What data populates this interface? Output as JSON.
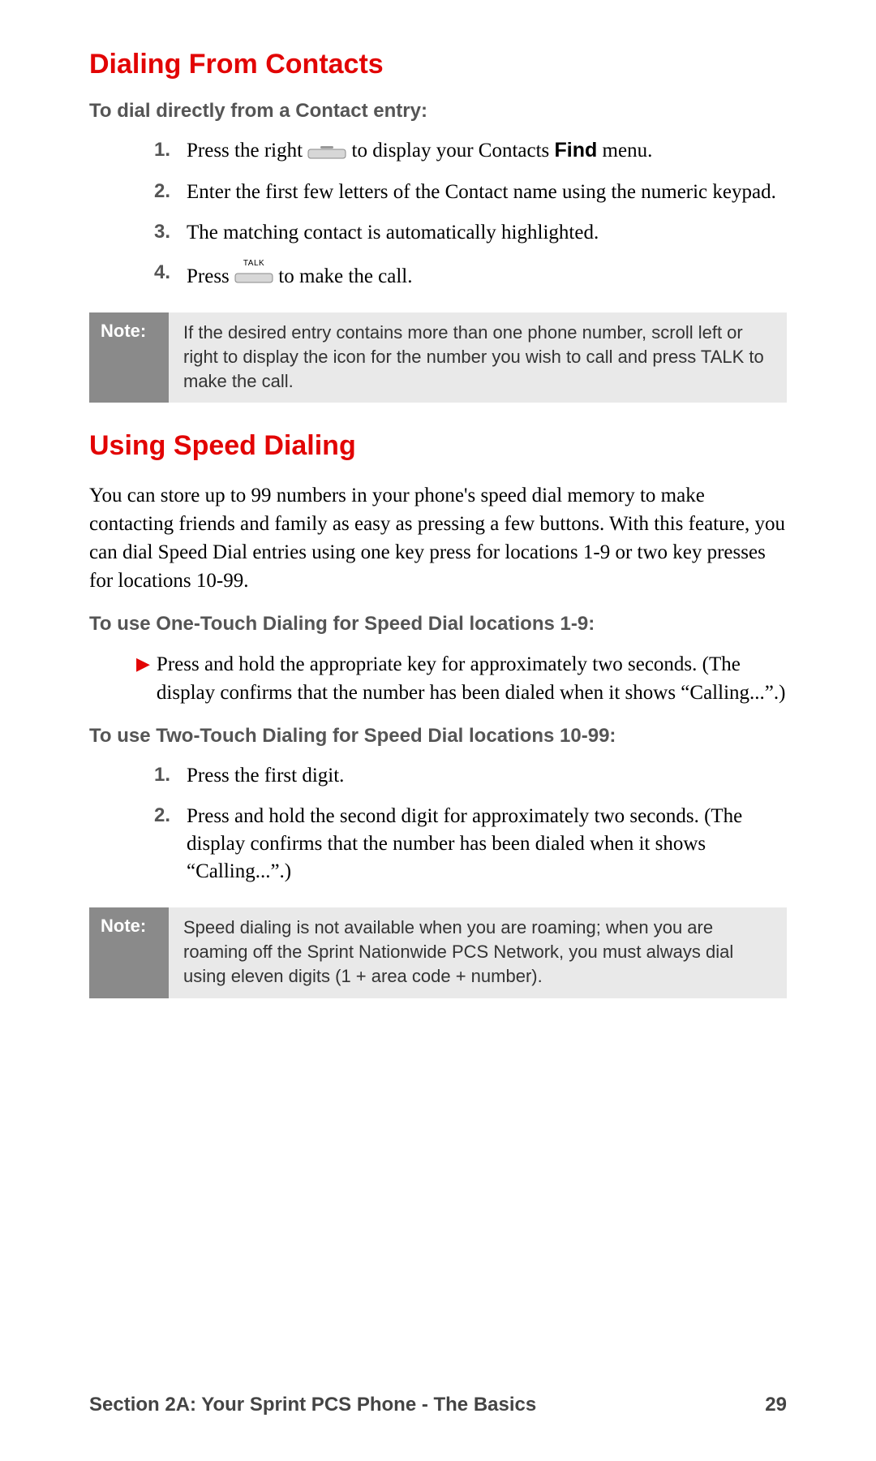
{
  "section1": {
    "heading": "Dialing From Contacts",
    "subhead": "To dial directly from a Contact entry:",
    "steps": [
      {
        "num": "1.",
        "pre": "Press the right ",
        "softkey": true,
        "mid": " to display your Contacts ",
        "bold": "Find",
        "post": " menu."
      },
      {
        "num": "2.",
        "text": "Enter the first few letters of the Contact name using the numeric keypad."
      },
      {
        "num": "3.",
        "text": "The matching contact is automatically highlighted."
      },
      {
        "num": "4.",
        "pre": "Press ",
        "talkkey": true,
        "post": " to make the call."
      }
    ],
    "note_label": "Note:",
    "note_text": "If the desired entry contains more than one phone number, scroll left or right to display the icon for the number you wish to call and press TALK to make the call."
  },
  "section2": {
    "heading": "Using Speed Dialing",
    "intro": "You can store up to 99 numbers in your phone's speed dial memory to make contacting friends and family as easy as pressing a few buttons. With this feature, you can dial Speed Dial entries using one key press for locations 1-9 or two key presses for locations 10-99.",
    "sub1": "To use One-Touch Dialing for Speed Dial locations 1-9:",
    "bullet1": "Press and hold the appropriate key for approximately two seconds. (The display confirms that the number has been dialed when it shows “Calling...”.)",
    "sub2": "To use Two-Touch Dialing for Speed Dial locations 10-99:",
    "steps2": [
      {
        "num": "1.",
        "text": "Press the first digit."
      },
      {
        "num": "2.",
        "text": "Press and hold the second digit for approximately two seconds. (The display confirms that the number has been dialed when it shows “Calling...”.)"
      }
    ],
    "note_label": "Note:",
    "note_text": "Speed dialing is not available when you are roaming; when you are roaming off the Sprint Nationwide PCS Network, you must always dial using eleven digits (1 + area code + number)."
  },
  "footer": {
    "section": "Section 2A: Your Sprint PCS Phone - The Basics",
    "page": "29"
  },
  "talk_label": "TALK"
}
